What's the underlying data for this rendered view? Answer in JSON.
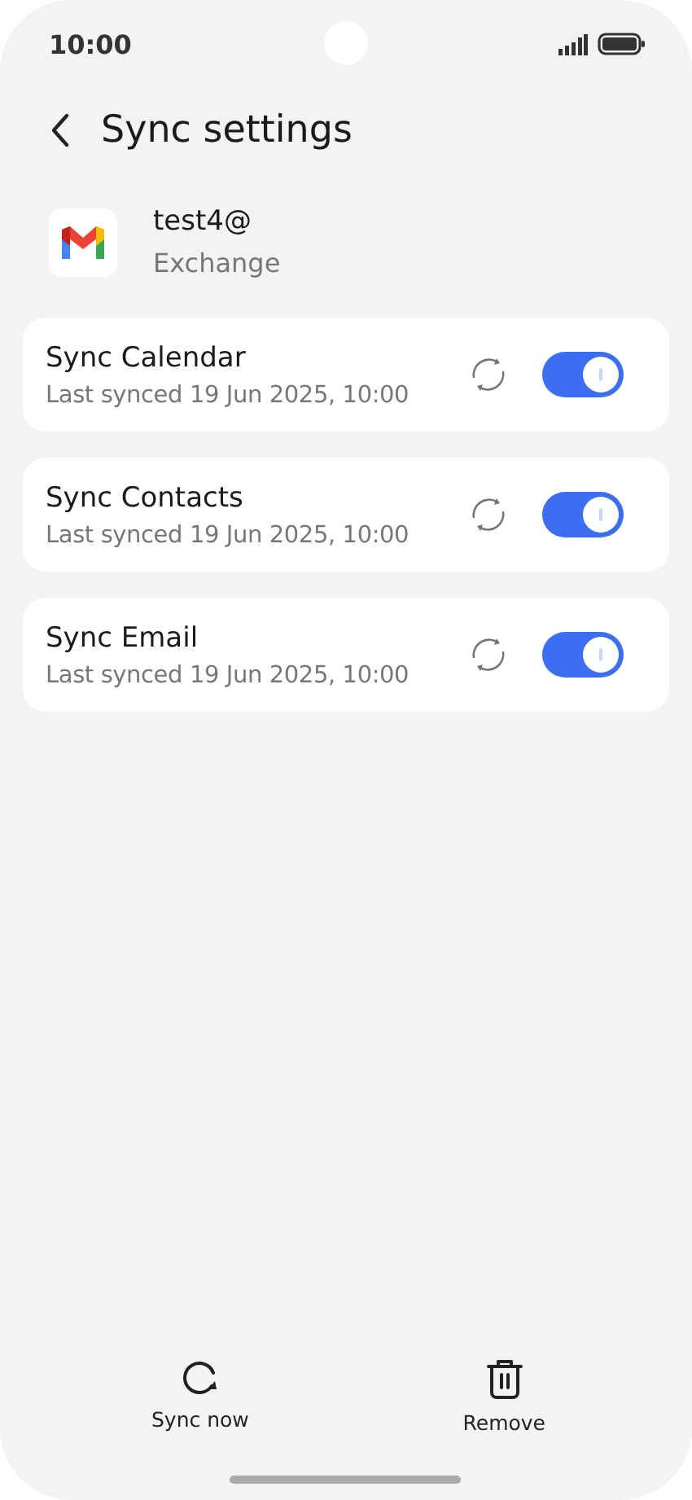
{
  "status_bar": {
    "time": "10:00"
  },
  "header": {
    "title": "Sync settings"
  },
  "account": {
    "name": "test4@",
    "type": "Exchange"
  },
  "sync_items": [
    {
      "title": "Sync Calendar",
      "subtitle": "Last synced 19 Jun 2025, 10:00",
      "on": true
    },
    {
      "title": "Sync Contacts",
      "subtitle": "Last synced 19 Jun 2025, 10:00",
      "on": true
    },
    {
      "title": "Sync Email",
      "subtitle": "Last synced 19 Jun 2025, 10:00",
      "on": true
    }
  ],
  "bottom_actions": [
    {
      "label": "Sync now",
      "kind": "sync"
    },
    {
      "label": "Remove",
      "kind": "delete"
    }
  ]
}
